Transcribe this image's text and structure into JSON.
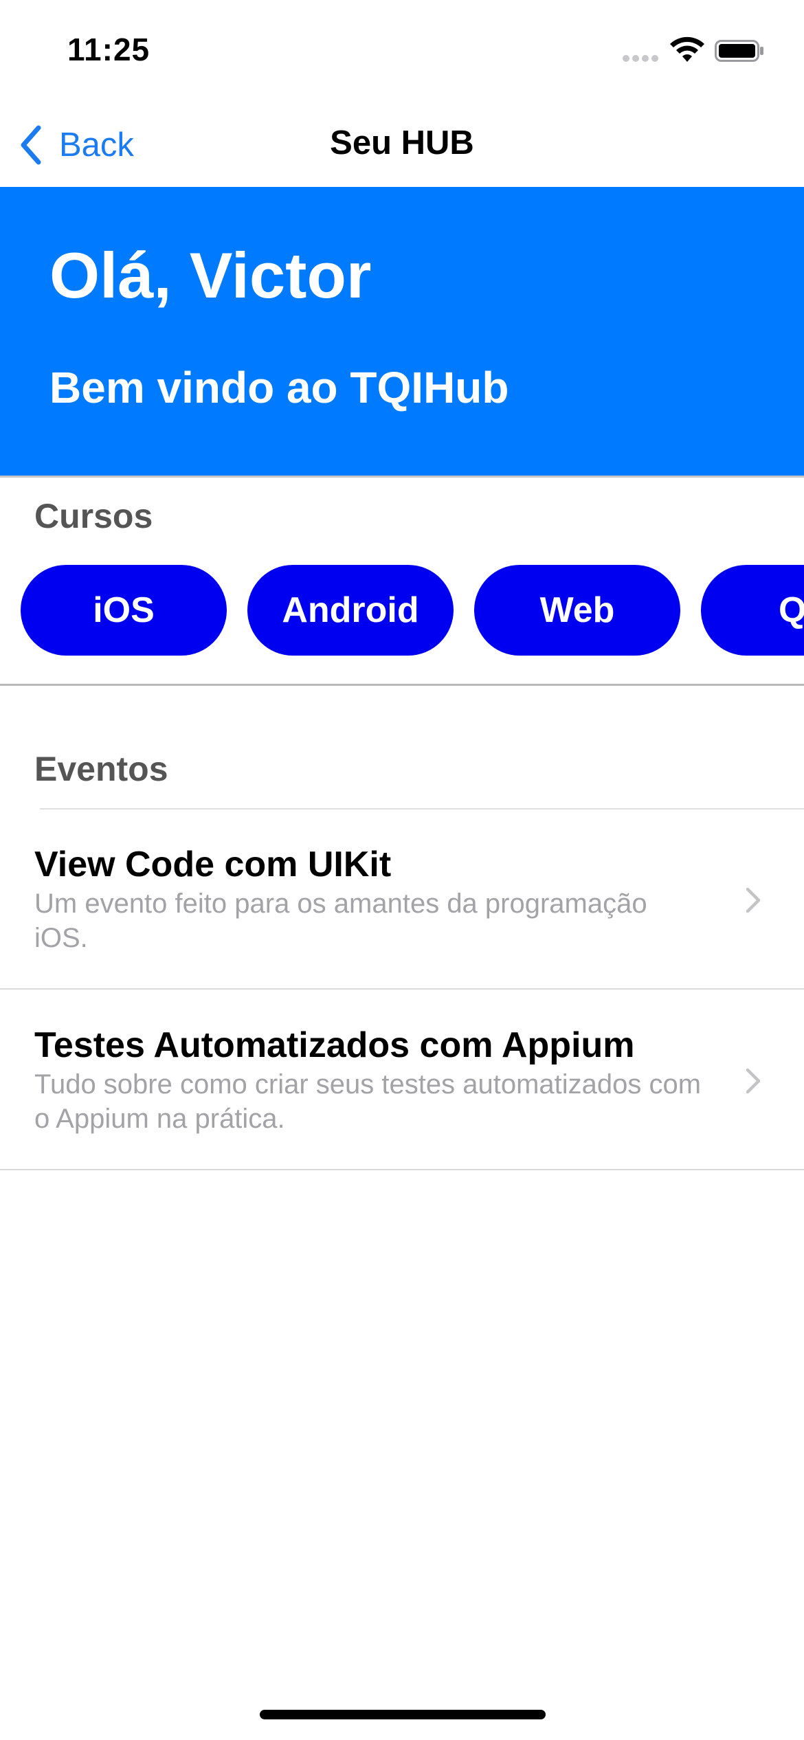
{
  "status_bar": {
    "time": "11:25",
    "icons": [
      "cellular-signal-icon",
      "wifi-icon",
      "battery-icon"
    ]
  },
  "nav": {
    "back_label": "Back",
    "title": "Seu HUB"
  },
  "hero": {
    "title": "Olá, Victor",
    "subtitle": "Bem vindo ao TQIHub",
    "background_color": "#007aff"
  },
  "courses": {
    "label": "Cursos",
    "chip_color": "#0000f0",
    "items": [
      "iOS",
      "Android",
      "Web",
      "Q"
    ]
  },
  "events": {
    "label": "Eventos",
    "items": [
      {
        "title": "View Code com UIKit",
        "description": "Um evento feito para os amantes da programação iOS."
      },
      {
        "title": "Testes Automatizados com Appium",
        "description": "Tudo sobre como criar seus testes automatizados com o Appium na prática."
      }
    ]
  },
  "colors": {
    "accent": "#1b7cf2",
    "secondary_text": "#a2a2a7"
  }
}
